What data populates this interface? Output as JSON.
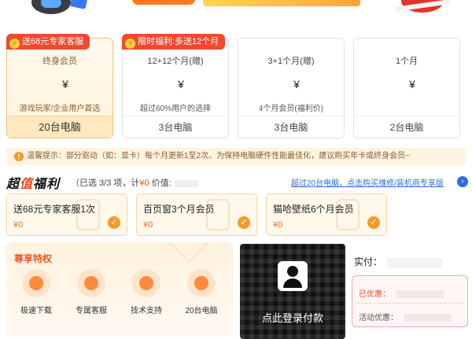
{
  "plans": [
    {
      "tag": "送68元专家客服",
      "name": "终身会员",
      "currency": "¥",
      "note": "游戏玩家/企业用户首选",
      "devices": "20台电脑",
      "selected": true
    },
    {
      "tag": "限时福利:多送12个月",
      "name": "12+12个月(赠)",
      "currency": "¥",
      "note": "超过60%用户的选择",
      "devices": "3台电脑",
      "selected": false
    },
    {
      "tag": "",
      "name": "3+1个月(赠)",
      "currency": "¥",
      "note": "4个月会员(福利价)",
      "devices": "3台电脑",
      "selected": false
    },
    {
      "tag": "",
      "name": "1个月",
      "currency": "¥",
      "note": "",
      "devices": "2台电脑",
      "selected": false
    }
  ],
  "notice": {
    "icon": "exclamation-icon",
    "text": "温馨提示：部分驱动（如：显卡）每个月更新1至2次。为保持电脑硬件性能最佳化，建议购买年卡或终身会员~"
  },
  "welfare": {
    "title_a": "超",
    "title_b": "值",
    "title_c": "福利",
    "summary_prefix": "（已选 3/3 项，计",
    "summary_amount": "¥0",
    "summary_suffix": "价值:",
    "link": "超过20台电脑，点击购买维修/装机商专享版",
    "link_icon": "arrow-right-icon",
    "gifts": [
      {
        "title": "送68元专家客服1次",
        "value": "¥0"
      },
      {
        "title": "百页窗3个月会员",
        "value": "¥0"
      },
      {
        "title": "猫哈壁纸6个月会员",
        "value": "¥0"
      }
    ]
  },
  "privileges": {
    "title": "尊享特权",
    "items": [
      {
        "icon": "rocket-icon",
        "label": "极速下载"
      },
      {
        "icon": "headset-icon",
        "label": "专属客服"
      },
      {
        "icon": "support-person-icon",
        "label": "技术支持"
      },
      {
        "icon": "monitor-icon",
        "label": "20台电脑"
      }
    ]
  },
  "qr": {
    "label": "点此登录付款"
  },
  "payment": {
    "actual_label": "实付：",
    "discount_label": "已优惠：",
    "promo_label": "活动优惠："
  },
  "colors": {
    "accent": "#e84a1f",
    "gold": "#f7c27a",
    "link": "#2f6de0"
  }
}
